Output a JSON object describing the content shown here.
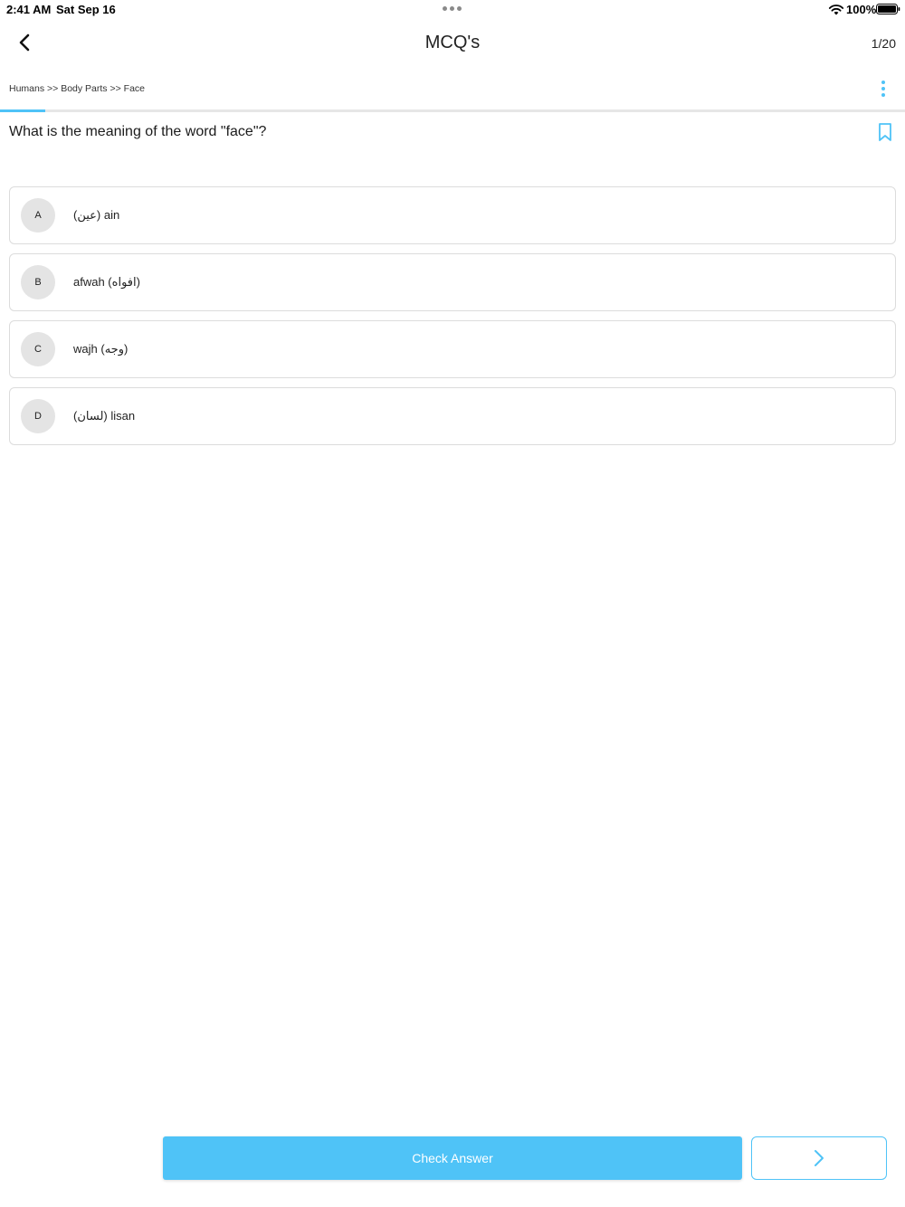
{
  "status_bar": {
    "time": "2:41 AM",
    "date": "Sat Sep 16",
    "battery": "100%",
    "icons": [
      "wifi-icon",
      "battery-icon"
    ]
  },
  "nav": {
    "title": "MCQ's",
    "counter": "1/20",
    "icons": [
      "chevron-left-icon",
      "more-vertical-icon",
      "bookmark-icon"
    ]
  },
  "breadcrumb": "Humans >> Body Parts >> Face",
  "progress": {
    "current": 1,
    "total": 20
  },
  "question": "What is the meaning of the word \"face\"?",
  "options": [
    {
      "letter": "A",
      "text": "(عين) ain"
    },
    {
      "letter": "B",
      "text": "afwah (افواه)"
    },
    {
      "letter": "C",
      "text": "wajh (وجه)"
    },
    {
      "letter": "D",
      "text": "(لسان) lisan"
    }
  ],
  "actions": {
    "check_answer": "Check Answer",
    "next_icon": "chevron-right-icon"
  },
  "colors": {
    "accent": "#4fc3f7",
    "option_circle": "#e4e4e4",
    "border": "#dcdcdc"
  }
}
